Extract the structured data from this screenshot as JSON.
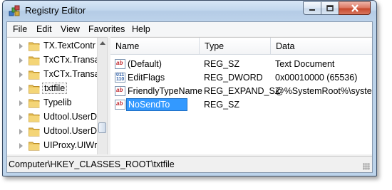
{
  "window": {
    "title": "Registry Editor",
    "controls": {
      "minimize": "–",
      "maximize": "□",
      "close": "✕"
    }
  },
  "menu": [
    "File",
    "Edit",
    "View",
    "Favorites",
    "Help"
  ],
  "tree": {
    "items": [
      {
        "label": "TX.TextContr",
        "selected": false
      },
      {
        "label": "TxCTx.Transa",
        "selected": false
      },
      {
        "label": "TxCTx.Transa",
        "selected": false
      },
      {
        "label": "txtfile",
        "selected": true
      },
      {
        "label": "Typelib",
        "selected": false
      },
      {
        "label": "Udtool.UserD",
        "selected": false
      },
      {
        "label": "Udtool.UserD",
        "selected": false
      },
      {
        "label": "UIProxy.UIWr",
        "selected": false
      }
    ]
  },
  "list": {
    "columns": [
      "Name",
      "Type",
      "Data"
    ],
    "rows": [
      {
        "icon": "string-value-icon",
        "name": "(Default)",
        "type": "REG_SZ",
        "data": "Text Document"
      },
      {
        "icon": "binary-value-icon",
        "name": "EditFlags",
        "type": "REG_DWORD",
        "data": "0x00010000 (65536)"
      },
      {
        "icon": "string-value-icon",
        "name": "FriendlyTypeName",
        "type": "REG_EXPAND_SZ",
        "data": "@%SystemRoot%\\systen"
      },
      {
        "icon": "string-value-icon",
        "name": "NoSendTo",
        "type": "REG_SZ",
        "data": "",
        "editing": true
      }
    ]
  },
  "status": {
    "path": "Computer\\HKEY_CLASSES_ROOT\\txtfile"
  },
  "colors": {
    "selection": "#3399ff",
    "titlebar": "#bcd3ea",
    "close_button": "#c84a2e"
  }
}
